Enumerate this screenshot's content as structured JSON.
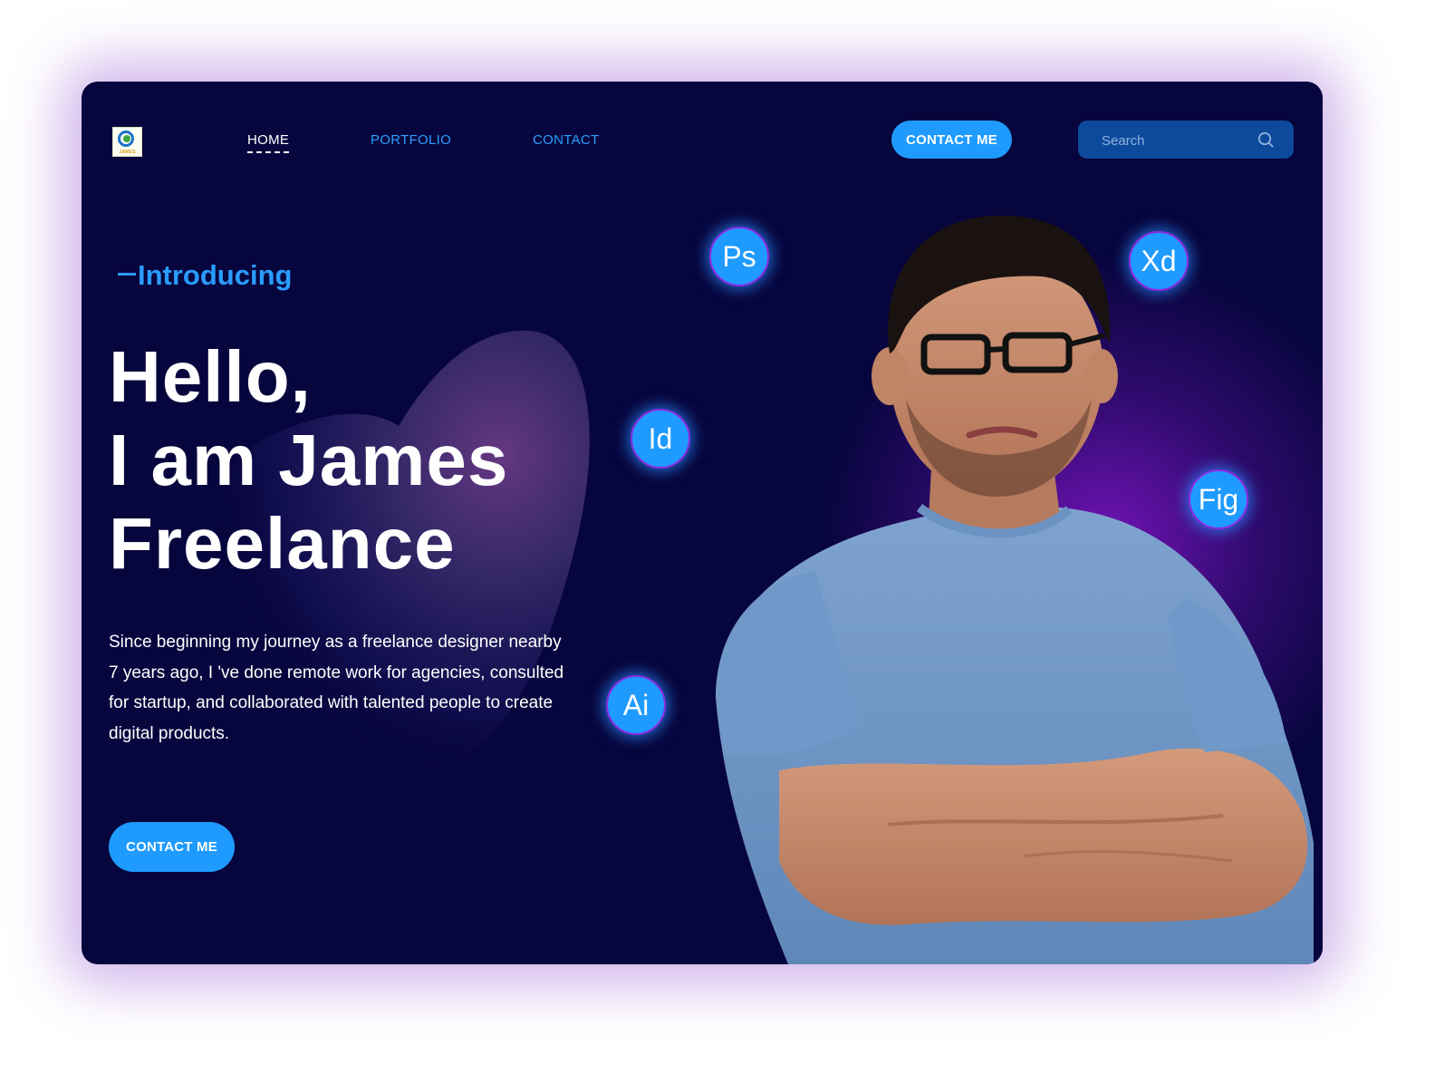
{
  "nav": {
    "logo_text": "JAMES",
    "links": [
      {
        "label": "HOME",
        "active": true
      },
      {
        "label": "PORTFOLIO",
        "active": false
      },
      {
        "label": "CONTACT",
        "active": false
      }
    ],
    "contact_button": "CONTACT ME",
    "search_placeholder": "Search"
  },
  "hero": {
    "intro": "Introducing",
    "title_lines": [
      "Hello,",
      "I am James",
      "Freelance"
    ],
    "bio": "Since beginning my journey as a freelance designer nearby 7 years ago, I 've done remote work for agencies, consulted for startup, and collaborated with talented people to create digital products.",
    "contact_button": "CONTACT ME"
  },
  "tools": [
    "Ps",
    "Xd",
    "Id",
    "Fig",
    "Ai"
  ],
  "colors": {
    "background": "#07053d",
    "accent": "#1f9bff",
    "glow": "#8a2be2",
    "search_bg": "#0d4a9c"
  },
  "icons": [
    "logo-icon",
    "search-icon"
  ]
}
